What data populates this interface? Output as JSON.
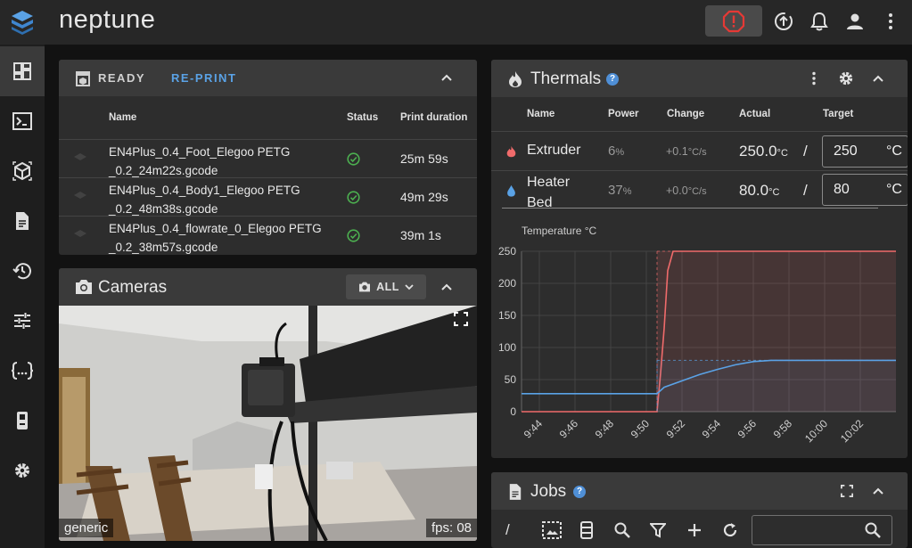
{
  "app": {
    "title": "neptune"
  },
  "colors": {
    "accent": "#5aa2e6",
    "extruder": "#f06b6b",
    "bed": "#5aa2e6",
    "success": "#4caf50",
    "emergency": "#e53935"
  },
  "sidebar": {
    "items": [
      {
        "icon": "dashboard-icon",
        "active": true
      },
      {
        "icon": "console-icon"
      },
      {
        "icon": "gcode-viewer-icon"
      },
      {
        "icon": "file-icon"
      },
      {
        "icon": "history-icon"
      },
      {
        "icon": "tune-icon"
      },
      {
        "icon": "code-braces-icon"
      },
      {
        "icon": "device-icon"
      },
      {
        "icon": "settings-icon"
      }
    ]
  },
  "status": {
    "state": "READY",
    "reprint": "RE-PRINT",
    "columns": [
      "Name",
      "Status",
      "Print duration"
    ],
    "rows": [
      {
        "name_line1": "EN4Plus_0.4_Foot_Elegoo PETG",
        "name_line2": "_0.2_24m22s.gcode",
        "duration": "25m 59s"
      },
      {
        "name_line1": "EN4Plus_0.4_Body1_Elegoo PETG",
        "name_line2": "_0.2_48m38s.gcode",
        "duration": "49m 29s"
      },
      {
        "name_line1": "EN4Plus_0.4_flowrate_0_Elegoo PETG",
        "name_line2": "_0.2_38m57s.gcode",
        "duration": "39m 1s"
      }
    ]
  },
  "cameras": {
    "title": "Cameras",
    "filter": "ALL",
    "camera_name": "generic",
    "fps": "fps: 08"
  },
  "thermals": {
    "title": "Thermals",
    "columns": [
      "Name",
      "Power",
      "Change",
      "Actual",
      "Target"
    ],
    "heaters": [
      {
        "name": "Extruder",
        "power": "6",
        "power_unit": "%",
        "change": "+0.1",
        "change_unit": "°C/s",
        "actual": "250.0",
        "actual_unit": "°C",
        "slash": "/",
        "target": "250",
        "target_unit": "°C"
      },
      {
        "name": "Heater Bed",
        "power": "37",
        "power_unit": "%",
        "change": "+0.0",
        "change_unit": "°C/s",
        "actual": "80.0",
        "actual_unit": "°C",
        "slash": "/",
        "target": "80",
        "target_unit": "°C"
      }
    ]
  },
  "jobs": {
    "title": "Jobs",
    "path": "/"
  },
  "chart_data": {
    "type": "line",
    "ylabel": "Temperature °C",
    "ylim": [
      0,
      250
    ],
    "yticks": [
      0,
      50,
      100,
      150,
      200,
      250
    ],
    "xlim": [
      "9:43",
      "10:04"
    ],
    "xticks": [
      "9:44",
      "9:46",
      "9:48",
      "9:50",
      "9:52",
      "9:54",
      "9:56",
      "9:58",
      "10:00",
      "10:02"
    ],
    "grid": true,
    "series": [
      {
        "name": "Extruder",
        "color": "#f06b6b",
        "x": [
          "9:43",
          "9:50.6",
          "9:50.8",
          "9:51.0",
          "9:51.2",
          "9:51.5",
          "10:04"
        ],
        "y": [
          0,
          0,
          60,
          130,
          220,
          250,
          250
        ],
        "target": 250
      },
      {
        "name": "Heater Bed",
        "color": "#5aa2e6",
        "x": [
          "9:43",
          "9:50.6",
          "9:51",
          "9:52",
          "9:53",
          "9:54",
          "9:55",
          "9:56",
          "9:57",
          "10:04"
        ],
        "y": [
          28,
          28,
          38,
          48,
          58,
          66,
          73,
          78,
          80,
          80
        ],
        "target": 80
      }
    ]
  }
}
